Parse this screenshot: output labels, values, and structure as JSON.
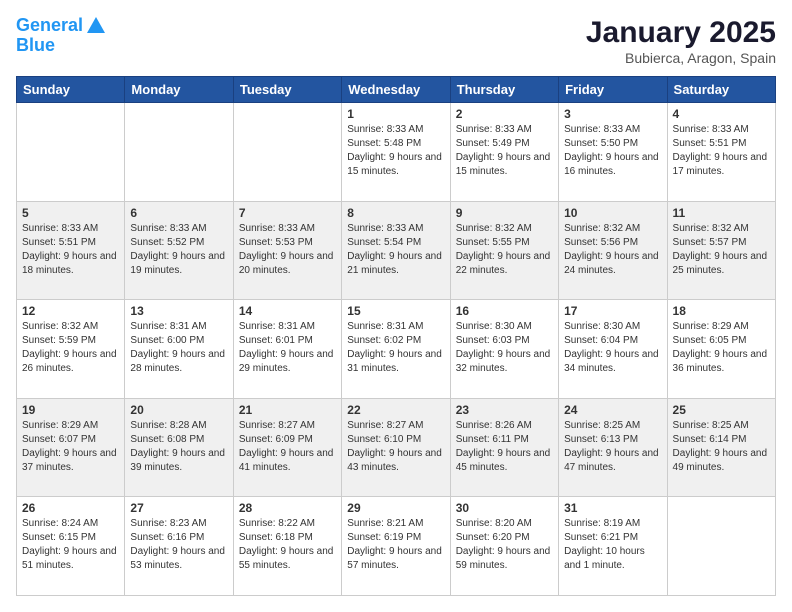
{
  "header": {
    "logo_line1": "General",
    "logo_line2": "Blue",
    "month_title": "January 2025",
    "location": "Bubierca, Aragon, Spain"
  },
  "weekdays": [
    "Sunday",
    "Monday",
    "Tuesday",
    "Wednesday",
    "Thursday",
    "Friday",
    "Saturday"
  ],
  "weeks": [
    {
      "shaded": false,
      "days": [
        {
          "num": "",
          "content": ""
        },
        {
          "num": "",
          "content": ""
        },
        {
          "num": "",
          "content": ""
        },
        {
          "num": "1",
          "content": "Sunrise: 8:33 AM\nSunset: 5:48 PM\nDaylight: 9 hours and 15 minutes."
        },
        {
          "num": "2",
          "content": "Sunrise: 8:33 AM\nSunset: 5:49 PM\nDaylight: 9 hours and 15 minutes."
        },
        {
          "num": "3",
          "content": "Sunrise: 8:33 AM\nSunset: 5:50 PM\nDaylight: 9 hours and 16 minutes."
        },
        {
          "num": "4",
          "content": "Sunrise: 8:33 AM\nSunset: 5:51 PM\nDaylight: 9 hours and 17 minutes."
        }
      ]
    },
    {
      "shaded": true,
      "days": [
        {
          "num": "5",
          "content": "Sunrise: 8:33 AM\nSunset: 5:51 PM\nDaylight: 9 hours and 18 minutes."
        },
        {
          "num": "6",
          "content": "Sunrise: 8:33 AM\nSunset: 5:52 PM\nDaylight: 9 hours and 19 minutes."
        },
        {
          "num": "7",
          "content": "Sunrise: 8:33 AM\nSunset: 5:53 PM\nDaylight: 9 hours and 20 minutes."
        },
        {
          "num": "8",
          "content": "Sunrise: 8:33 AM\nSunset: 5:54 PM\nDaylight: 9 hours and 21 minutes."
        },
        {
          "num": "9",
          "content": "Sunrise: 8:32 AM\nSunset: 5:55 PM\nDaylight: 9 hours and 22 minutes."
        },
        {
          "num": "10",
          "content": "Sunrise: 8:32 AM\nSunset: 5:56 PM\nDaylight: 9 hours and 24 minutes."
        },
        {
          "num": "11",
          "content": "Sunrise: 8:32 AM\nSunset: 5:57 PM\nDaylight: 9 hours and 25 minutes."
        }
      ]
    },
    {
      "shaded": false,
      "days": [
        {
          "num": "12",
          "content": "Sunrise: 8:32 AM\nSunset: 5:59 PM\nDaylight: 9 hours and 26 minutes."
        },
        {
          "num": "13",
          "content": "Sunrise: 8:31 AM\nSunset: 6:00 PM\nDaylight: 9 hours and 28 minutes."
        },
        {
          "num": "14",
          "content": "Sunrise: 8:31 AM\nSunset: 6:01 PM\nDaylight: 9 hours and 29 minutes."
        },
        {
          "num": "15",
          "content": "Sunrise: 8:31 AM\nSunset: 6:02 PM\nDaylight: 9 hours and 31 minutes."
        },
        {
          "num": "16",
          "content": "Sunrise: 8:30 AM\nSunset: 6:03 PM\nDaylight: 9 hours and 32 minutes."
        },
        {
          "num": "17",
          "content": "Sunrise: 8:30 AM\nSunset: 6:04 PM\nDaylight: 9 hours and 34 minutes."
        },
        {
          "num": "18",
          "content": "Sunrise: 8:29 AM\nSunset: 6:05 PM\nDaylight: 9 hours and 36 minutes."
        }
      ]
    },
    {
      "shaded": true,
      "days": [
        {
          "num": "19",
          "content": "Sunrise: 8:29 AM\nSunset: 6:07 PM\nDaylight: 9 hours and 37 minutes."
        },
        {
          "num": "20",
          "content": "Sunrise: 8:28 AM\nSunset: 6:08 PM\nDaylight: 9 hours and 39 minutes."
        },
        {
          "num": "21",
          "content": "Sunrise: 8:27 AM\nSunset: 6:09 PM\nDaylight: 9 hours and 41 minutes."
        },
        {
          "num": "22",
          "content": "Sunrise: 8:27 AM\nSunset: 6:10 PM\nDaylight: 9 hours and 43 minutes."
        },
        {
          "num": "23",
          "content": "Sunrise: 8:26 AM\nSunset: 6:11 PM\nDaylight: 9 hours and 45 minutes."
        },
        {
          "num": "24",
          "content": "Sunrise: 8:25 AM\nSunset: 6:13 PM\nDaylight: 9 hours and 47 minutes."
        },
        {
          "num": "25",
          "content": "Sunrise: 8:25 AM\nSunset: 6:14 PM\nDaylight: 9 hours and 49 minutes."
        }
      ]
    },
    {
      "shaded": false,
      "days": [
        {
          "num": "26",
          "content": "Sunrise: 8:24 AM\nSunset: 6:15 PM\nDaylight: 9 hours and 51 minutes."
        },
        {
          "num": "27",
          "content": "Sunrise: 8:23 AM\nSunset: 6:16 PM\nDaylight: 9 hours and 53 minutes."
        },
        {
          "num": "28",
          "content": "Sunrise: 8:22 AM\nSunset: 6:18 PM\nDaylight: 9 hours and 55 minutes."
        },
        {
          "num": "29",
          "content": "Sunrise: 8:21 AM\nSunset: 6:19 PM\nDaylight: 9 hours and 57 minutes."
        },
        {
          "num": "30",
          "content": "Sunrise: 8:20 AM\nSunset: 6:20 PM\nDaylight: 9 hours and 59 minutes."
        },
        {
          "num": "31",
          "content": "Sunrise: 8:19 AM\nSunset: 6:21 PM\nDaylight: 10 hours and 1 minute."
        },
        {
          "num": "",
          "content": ""
        }
      ]
    }
  ]
}
